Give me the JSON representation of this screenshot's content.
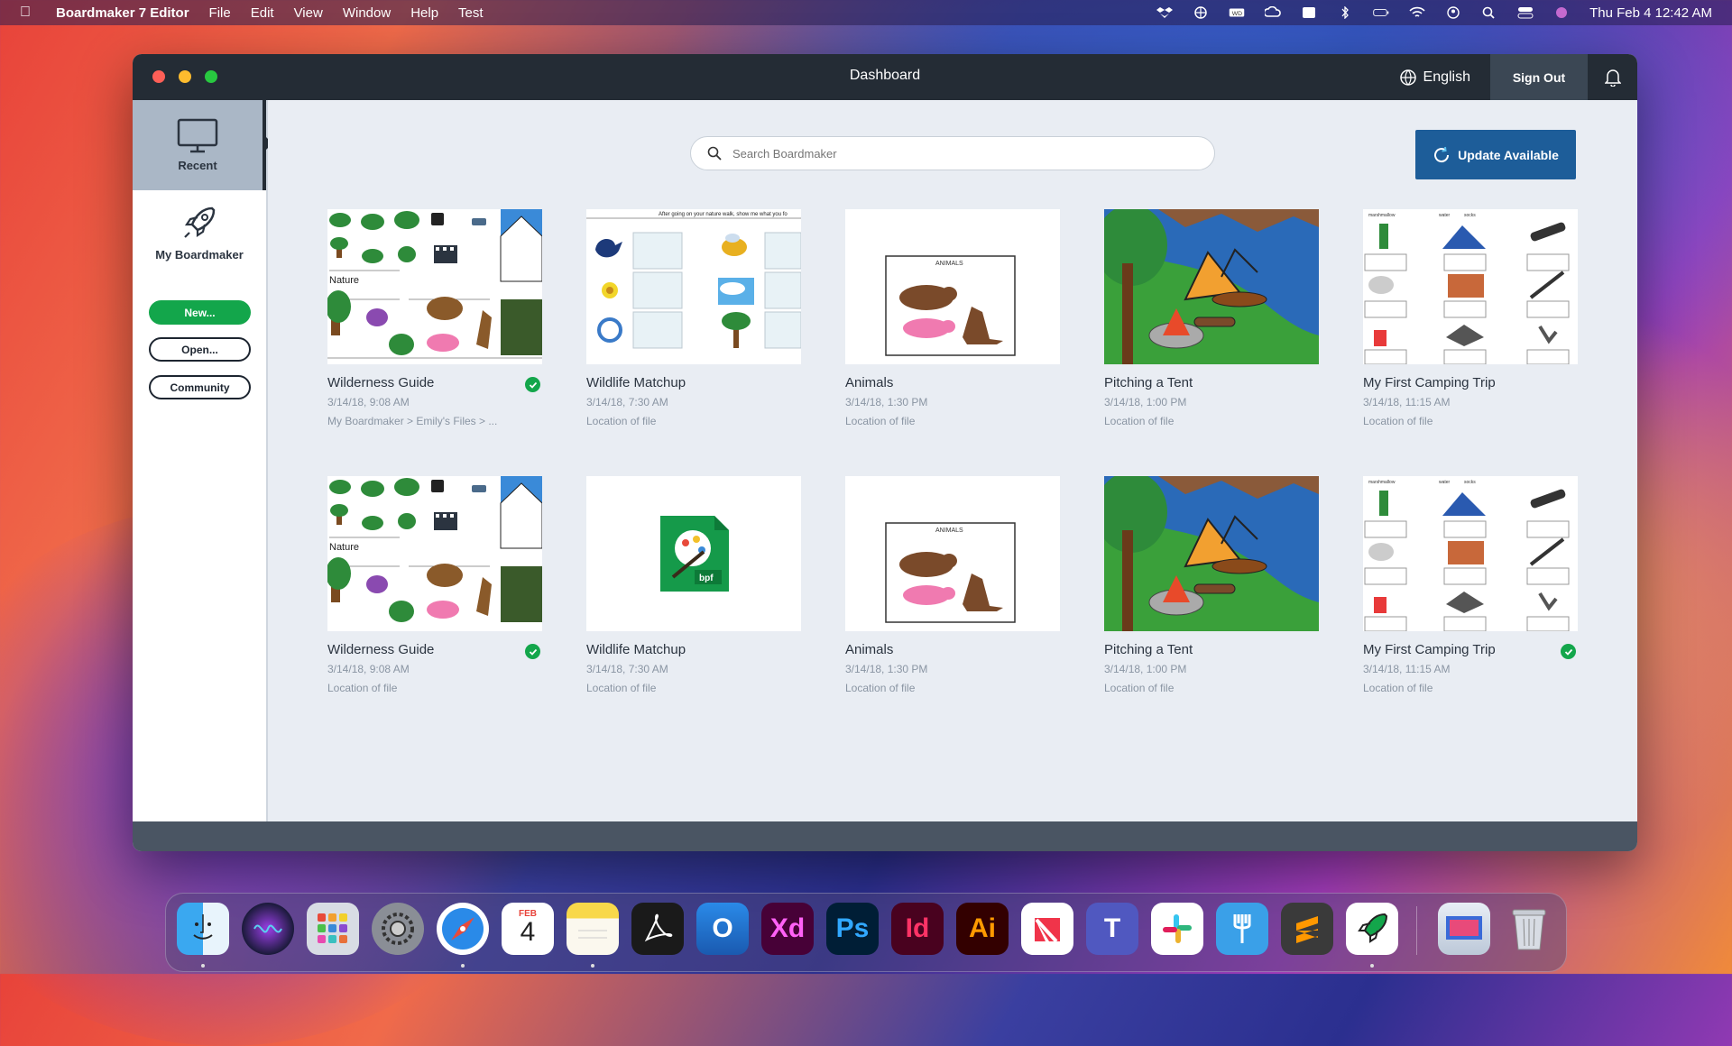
{
  "menubar": {
    "app_name": "Boardmaker 7 Editor",
    "items": [
      "File",
      "Edit",
      "View",
      "Window",
      "Help",
      "Test"
    ],
    "clock": "Thu Feb 4  12:42 AM"
  },
  "window": {
    "title": "Dashboard",
    "language": "English",
    "sign_out": "Sign Out"
  },
  "sidebar": {
    "recent": "Recent",
    "my_boardmaker": "My Boardmaker",
    "new_btn": "New...",
    "open_btn": "Open...",
    "community_btn": "Community"
  },
  "search": {
    "placeholder": "Search Boardmaker"
  },
  "update_btn": "Update Available",
  "cards": [
    {
      "title": "Wilderness Guide",
      "date": "3/14/18, 9:08 AM",
      "location": "My Boardmaker > Emily's Files > ...",
      "checked": true
    },
    {
      "title": "Wildlife Matchup",
      "date": "3/14/18, 7:30 AM",
      "location": "Location of file",
      "checked": false
    },
    {
      "title": "Animals",
      "date": "3/14/18, 1:30 PM",
      "location": "Location of file",
      "checked": false
    },
    {
      "title": "Pitching a Tent",
      "date": "3/14/18, 1:00 PM",
      "location": "Location of file",
      "checked": false
    },
    {
      "title": "My First Camping Trip",
      "date": "3/14/18, 11:15 AM",
      "location": "Location of file",
      "checked": false
    },
    {
      "title": "Wilderness Guide",
      "date": "3/14/18, 9:08 AM",
      "location": "Location of file",
      "checked": true
    },
    {
      "title": "Wildlife Matchup",
      "date": "3/14/18, 7:30 AM",
      "location": "Location of file",
      "checked": false
    },
    {
      "title": "Animals",
      "date": "3/14/18, 1:30 PM",
      "location": "Location of file",
      "checked": false
    },
    {
      "title": "Pitching a Tent",
      "date": "3/14/18, 1:00 PM",
      "location": "Location of file",
      "checked": false
    },
    {
      "title": "My First Camping Trip",
      "date": "3/14/18, 11:15 AM",
      "location": "Location of file",
      "checked": true
    }
  ],
  "thumb_text": {
    "nature": "Nature",
    "matchup_header": "After going on your nature walk, show me what you fo",
    "animals_label": "ANIMALS",
    "bpf": "bpf",
    "marshmallow": "marshmallow",
    "water": "water",
    "socks": "socks"
  },
  "dock": {
    "calendar_month": "FEB",
    "calendar_day": "4",
    "apps": [
      "Finder",
      "Siri",
      "Launchpad",
      "System Preferences",
      "Safari",
      "Calendar",
      "Notes",
      "Acrobat",
      "Outlook",
      "Xd",
      "Ps",
      "Id",
      "Ai",
      "News",
      "Teams",
      "Slack",
      "Fork",
      "Sublime Text",
      "Boardmaker",
      "Photos Screen",
      "Trash"
    ],
    "labels": {
      "outlook": "O",
      "xd": "Xd",
      "ps": "Ps",
      "id": "Id",
      "ai": "Ai",
      "teams": "T"
    }
  },
  "colors": {
    "accent_green": "#13a64b",
    "update_blue": "#1d5d99",
    "titlebar": "#242c35"
  }
}
